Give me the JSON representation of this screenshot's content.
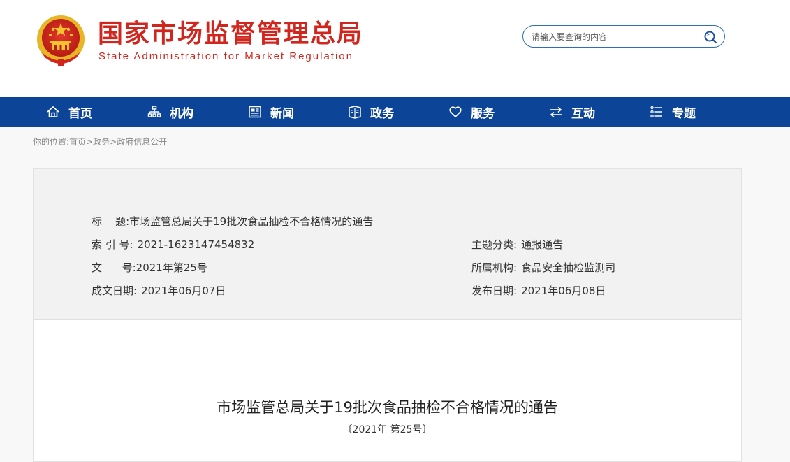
{
  "header": {
    "title_cn": "国家市场监督管理总局",
    "title_en": "State Administration for Market Regulation",
    "search_placeholder": "请输入要查询的内容"
  },
  "nav": {
    "items": [
      {
        "label": "首页",
        "icon": "home-icon"
      },
      {
        "label": "机构",
        "icon": "org-icon"
      },
      {
        "label": "新闻",
        "icon": "news-icon"
      },
      {
        "label": "政务",
        "icon": "affairs-icon"
      },
      {
        "label": "服务",
        "icon": "heart-icon"
      },
      {
        "label": "互动",
        "icon": "exchange-icon"
      },
      {
        "label": "专题",
        "icon": "topic-icon"
      }
    ]
  },
  "breadcrumb": {
    "prefix": "你的位置:",
    "items": [
      "首页",
      "政务",
      "政府信息公开"
    ],
    "separator": ">"
  },
  "meta": {
    "title_label": "标      题:",
    "title_value": "市场监管总局关于19批次食品抽检不合格情况的通告",
    "index_label": "索 引 号:",
    "index_value": "2021-1623147454832",
    "topic_label": "主题分类:",
    "topic_value": "通报通告",
    "docno_label": "文      号:",
    "docno_value": "2021年第25号",
    "org_label": "所属机构:",
    "org_value": "食品安全抽检监测司",
    "created_label": "成文日期:",
    "created_value": "2021年06月07日",
    "published_label": "发布日期:",
    "published_value": "2021年06月08日"
  },
  "document": {
    "title": "市场监管总局关于19批次食品抽检不合格情况的通告",
    "number": "〔2021年 第25号〕"
  },
  "colors": {
    "brand_red": "#d0261e",
    "nav_blue": "#0c4597",
    "search_border": "#2f6db5"
  }
}
